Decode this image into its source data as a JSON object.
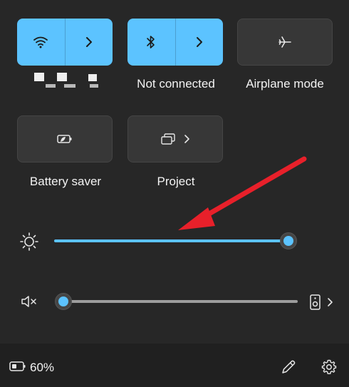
{
  "tiles": {
    "wifi": {
      "label": "",
      "redacted": true
    },
    "bluetooth": {
      "label": "Not connected"
    },
    "airplane": {
      "label": "Airplane mode"
    },
    "battery_saver": {
      "label": "Battery saver"
    },
    "project": {
      "label": "Project"
    }
  },
  "brightness": {
    "level_percent": 100
  },
  "volume": {
    "level_percent": 0,
    "muted": true
  },
  "footer": {
    "battery_text": "60%"
  },
  "colors": {
    "accent": "#5cc3ff",
    "tile": "#373737",
    "panel": "#272727",
    "annotation_arrow": "#e8202a"
  },
  "icons": [
    "wifi-icon",
    "chevron-right-icon",
    "bluetooth-icon",
    "airplane-icon",
    "battery-saver-icon",
    "project-icon",
    "sun-icon",
    "volume-muted-icon",
    "speaker-icon",
    "battery-icon",
    "pencil-icon",
    "gear-icon"
  ]
}
